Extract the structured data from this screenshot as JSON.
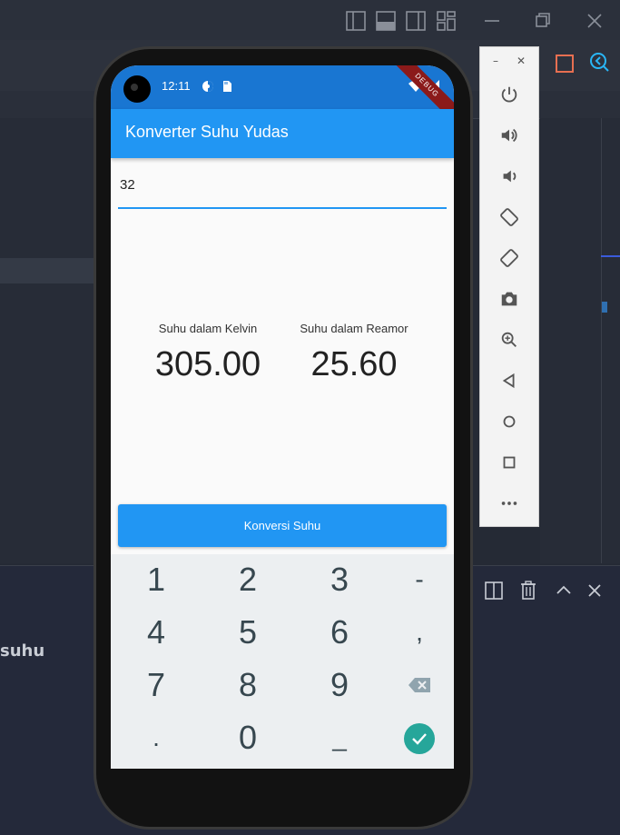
{
  "app": {
    "title": "Konverter Suhu Yudas"
  },
  "status_bar": {
    "time": "12:11",
    "ribbon": "DEBUG"
  },
  "input": {
    "value": "32"
  },
  "results": {
    "kelvin_label": "Suhu dalam Kelvin",
    "kelvin_value": "305.00",
    "reamur_label": "Suhu dalam Reamor",
    "reamur_value": "25.60"
  },
  "convert_button": {
    "label": "Konversi Suhu"
  },
  "keypad": {
    "keys": [
      "1",
      "2",
      "3",
      "-",
      "4",
      "5",
      "6",
      ",",
      "7",
      "8",
      "9",
      ".",
      "0",
      "_"
    ]
  },
  "ide": {
    "bottom_text": "suhu"
  },
  "colors": {
    "accent": "#2196f3",
    "status_bar": "#1976d2",
    "done_key": "#26a69a"
  }
}
